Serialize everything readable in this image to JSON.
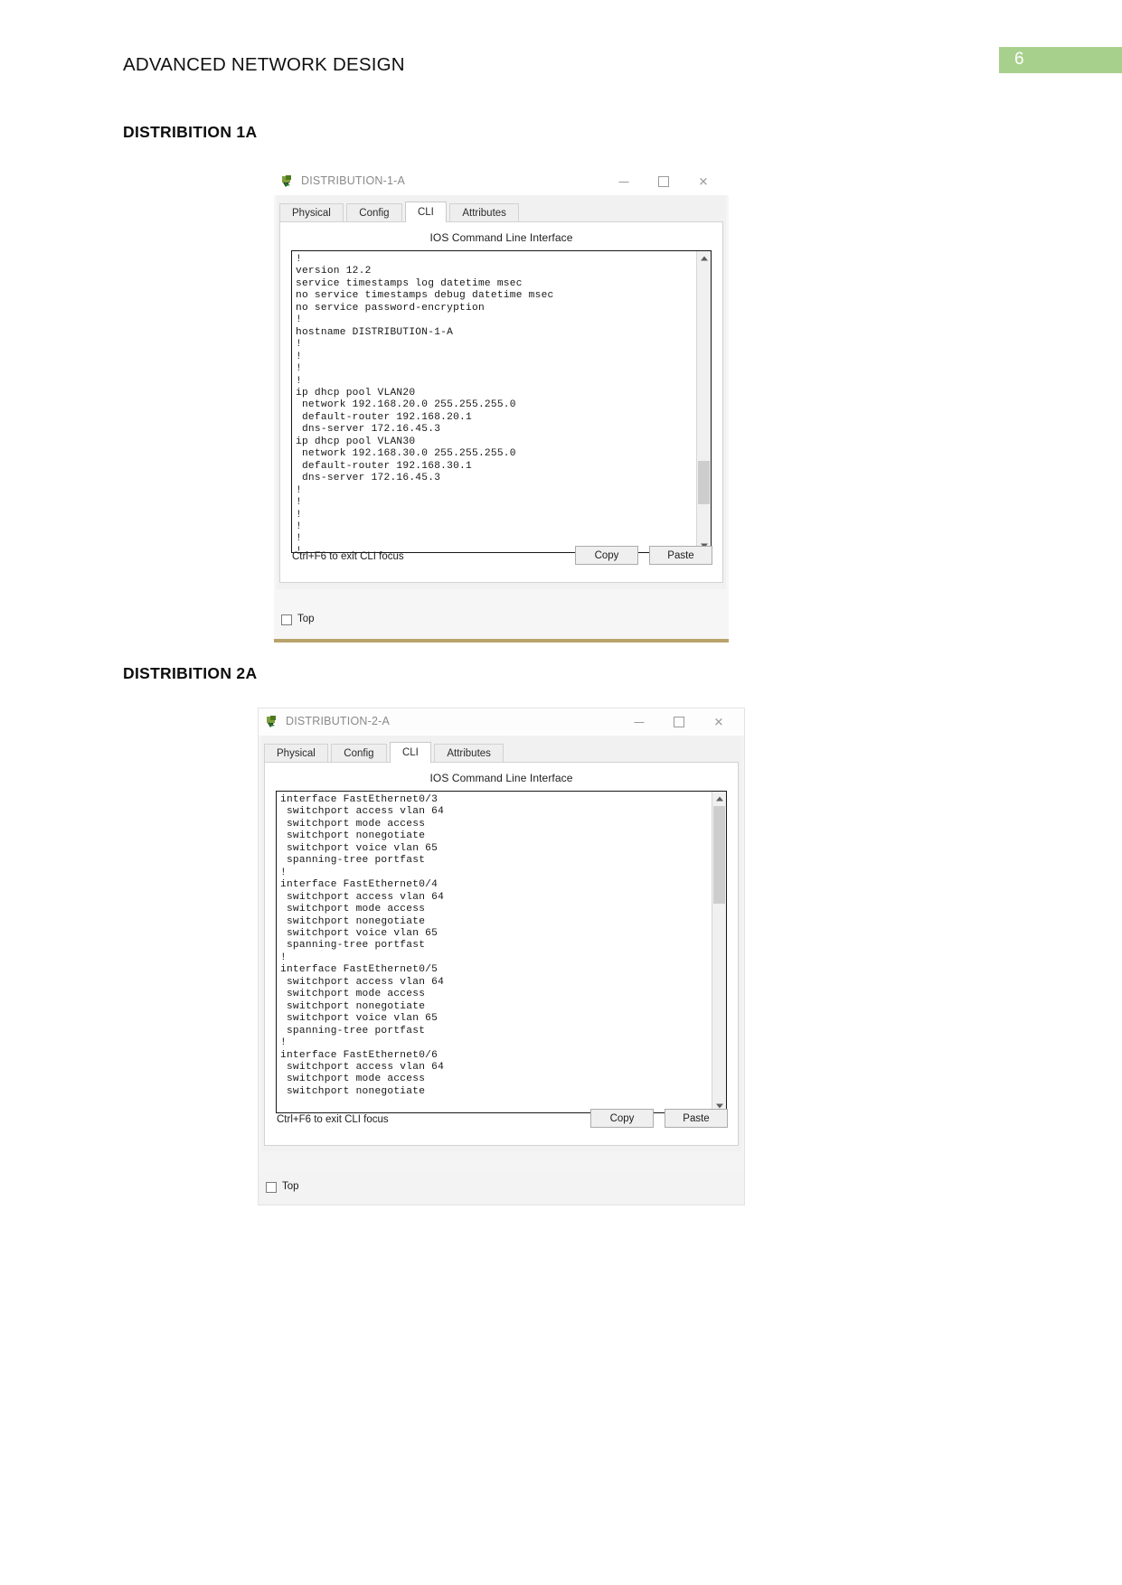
{
  "header": {
    "document_title": "ADVANCED NETWORK DESIGN",
    "page_number": "6",
    "badge_color": "#a8d08d"
  },
  "sections": [
    {
      "heading": "DISTRIBITION 1A"
    },
    {
      "heading": "DISTRIBITION 2A"
    }
  ],
  "windows": [
    {
      "title": "DISTRIBUTION-1-A",
      "icon": "packet-tracer-device-icon",
      "controls": {
        "minimize": "–",
        "maximize": "□",
        "close": "✕"
      },
      "tabs": [
        {
          "label": "Physical",
          "active": false
        },
        {
          "label": "Config",
          "active": false
        },
        {
          "label": "CLI",
          "active": true
        },
        {
          "label": "Attributes",
          "active": false
        }
      ],
      "cli_heading": "IOS Command Line Interface",
      "cli_text": "!\nversion 12.2\nservice timestamps log datetime msec\nno service timestamps debug datetime msec\nno service password-encryption\n!\nhostname DISTRIBUTION-1-A\n!\n!\n!\n!\nip dhcp pool VLAN20\n network 192.168.20.0 255.255.255.0\n default-router 192.168.20.1\n dns-server 172.16.45.3\nip dhcp pool VLAN30\n network 192.168.30.0 255.255.255.0\n default-router 192.168.30.1\n dns-server 172.16.45.3\n!\n!\n!\n!\n!\n!",
      "focus_hint": "Ctrl+F6 to exit CLI focus",
      "copy_button": "Copy",
      "paste_button": "Paste",
      "top_checkbox_label": "Top",
      "top_checkbox_checked": false
    },
    {
      "title": "DISTRIBUTION-2-A",
      "icon": "packet-tracer-device-icon",
      "controls": {
        "minimize": "–",
        "maximize": "□",
        "close": "✕"
      },
      "tabs": [
        {
          "label": "Physical",
          "active": false
        },
        {
          "label": "Config",
          "active": false
        },
        {
          "label": "CLI",
          "active": true
        },
        {
          "label": "Attributes",
          "active": false
        }
      ],
      "cli_heading": "IOS Command Line Interface",
      "cli_text": "interface FastEthernet0/3\n switchport access vlan 64\n switchport mode access\n switchport nonegotiate\n switchport voice vlan 65\n spanning-tree portfast\n!\ninterface FastEthernet0/4\n switchport access vlan 64\n switchport mode access\n switchport nonegotiate\n switchport voice vlan 65\n spanning-tree portfast\n!\ninterface FastEthernet0/5\n switchport access vlan 64\n switchport mode access\n switchport nonegotiate\n switchport voice vlan 65\n spanning-tree portfast\n!\ninterface FastEthernet0/6\n switchport access vlan 64\n switchport mode access\n switchport nonegotiate",
      "focus_hint": "Ctrl+F6 to exit CLI focus",
      "copy_button": "Copy",
      "paste_button": "Paste",
      "top_checkbox_label": "Top",
      "top_checkbox_checked": false
    }
  ]
}
